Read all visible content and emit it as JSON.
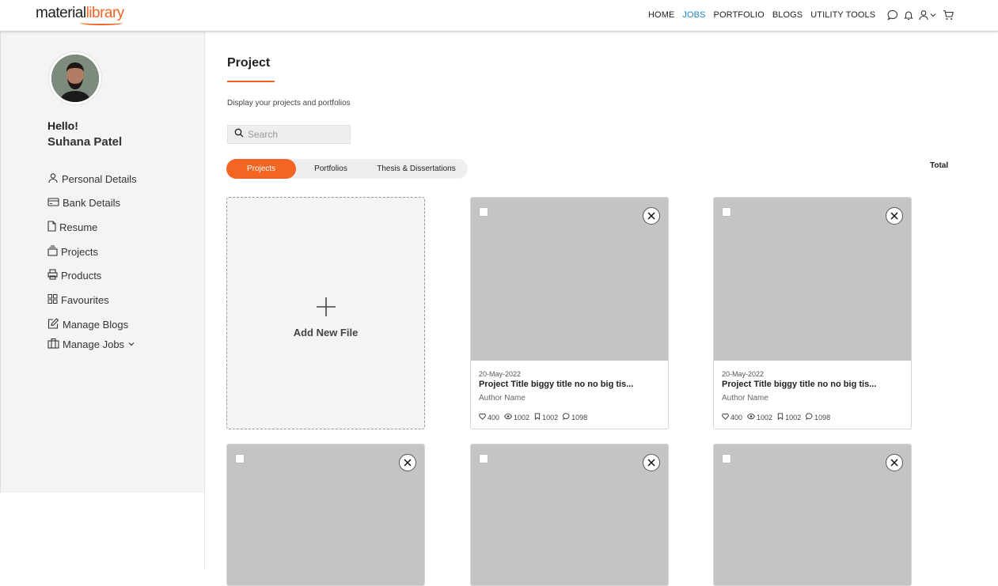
{
  "logo": {
    "part1": "material",
    "part2": "library"
  },
  "nav": {
    "items": [
      "HOME",
      "JOBS",
      "PORTFOLIO",
      "BLOGS",
      "UTILITY TOOLS"
    ],
    "active": "JOBS"
  },
  "profile": {
    "greeting": "Hello!",
    "name": "Suhana Patel"
  },
  "sidebar": {
    "items": [
      {
        "label": "Personal Details",
        "icon": "user-icon"
      },
      {
        "label": "Bank Details",
        "icon": "card-icon"
      },
      {
        "label": "Resume",
        "icon": "file-icon"
      },
      {
        "label": "Projects",
        "icon": "stack-icon"
      },
      {
        "label": "Products",
        "icon": "printer-icon"
      },
      {
        "label": "Favourites",
        "icon": "grid-icon"
      },
      {
        "label": "Manage Blogs",
        "icon": "edit-icon"
      },
      {
        "label": "Manage Jobs",
        "icon": "briefcase-icon"
      }
    ]
  },
  "main": {
    "title": "Project",
    "subtitle": "Display your projects and portfolios",
    "search_placeholder": "Search",
    "tabs": [
      "Projects",
      "Portfolios",
      "Thesis & Dissertations"
    ],
    "active_tab": "Projects",
    "total_label": "Total",
    "add_label": "Add New File",
    "cards": [
      {
        "date": "20-May-2022",
        "title": "Project Title biggy title no no big tis...",
        "author": "Author Name",
        "likes": "400",
        "views": "1002",
        "saves": "1002",
        "comments": "1098"
      },
      {
        "date": "20-May-2022",
        "title": "Project Title biggy title no no big tis...",
        "author": "Author Name",
        "likes": "400",
        "views": "1002",
        "saves": "1002",
        "comments": "1098"
      }
    ]
  },
  "colors": {
    "accent": "#f26522",
    "nav_active": "#1e88c7",
    "thumb": "#c4c4c4"
  }
}
